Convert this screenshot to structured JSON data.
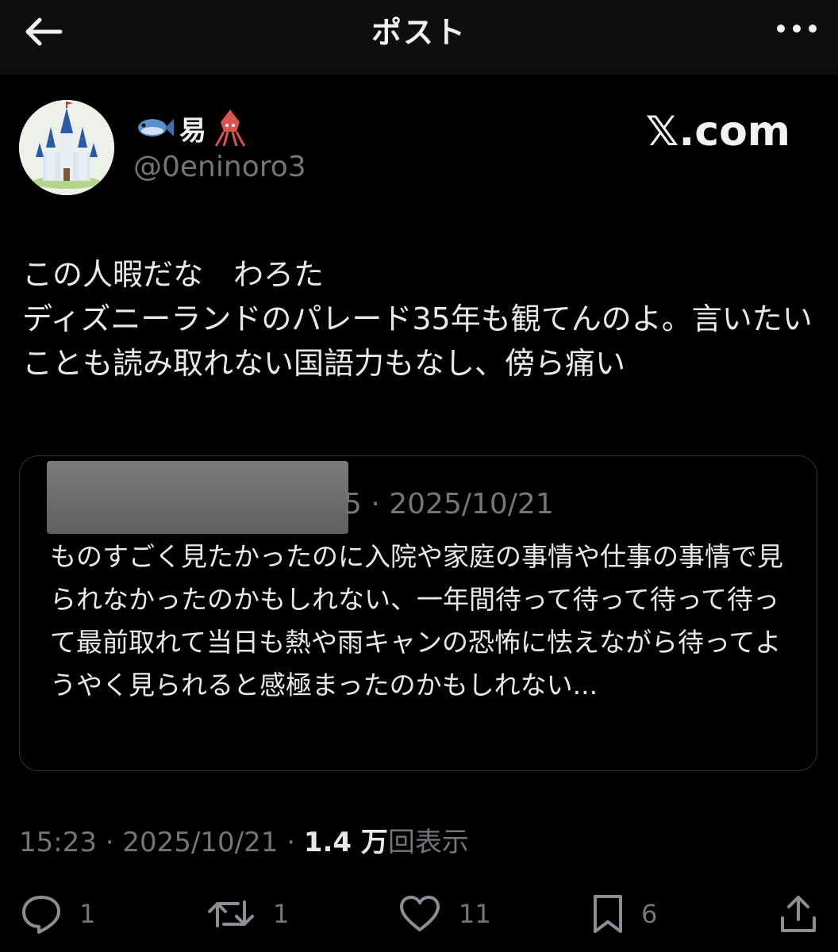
{
  "header": {
    "title": "ポスト"
  },
  "author": {
    "name": "易",
    "handle": "@0eninoro3",
    "brand": "𝕏.com"
  },
  "post": {
    "text": "この人暇だな　わろた\nディズニーランドのパレード35年も観てんのよ。言いたいことも読み取れない国語力もなし、傍ら痛い"
  },
  "quote": {
    "meta": "5 · 2025/10/21",
    "text": "ものすごく見たかったのに入院や家庭の事情や仕事の事情で見られなかったのかもしれない、一年間待って待って待って待って最前取れて当日も熱や雨キャンの恐怖に怯えながら待ってようやく見られると感極まったのかもしれない..."
  },
  "meta": {
    "time": "15:23",
    "date": "2025/10/21",
    "views_count": "1.4 万",
    "views_label": "回表示"
  },
  "actions": {
    "replies": "1",
    "reposts": "1",
    "likes": "11",
    "bookmarks": "6"
  },
  "icons": [
    "back-arrow-icon",
    "more-icon",
    "fish-emoji-icon",
    "squid-emoji-icon",
    "reply-icon",
    "repost-icon",
    "like-icon",
    "bookmark-icon",
    "share-icon"
  ]
}
